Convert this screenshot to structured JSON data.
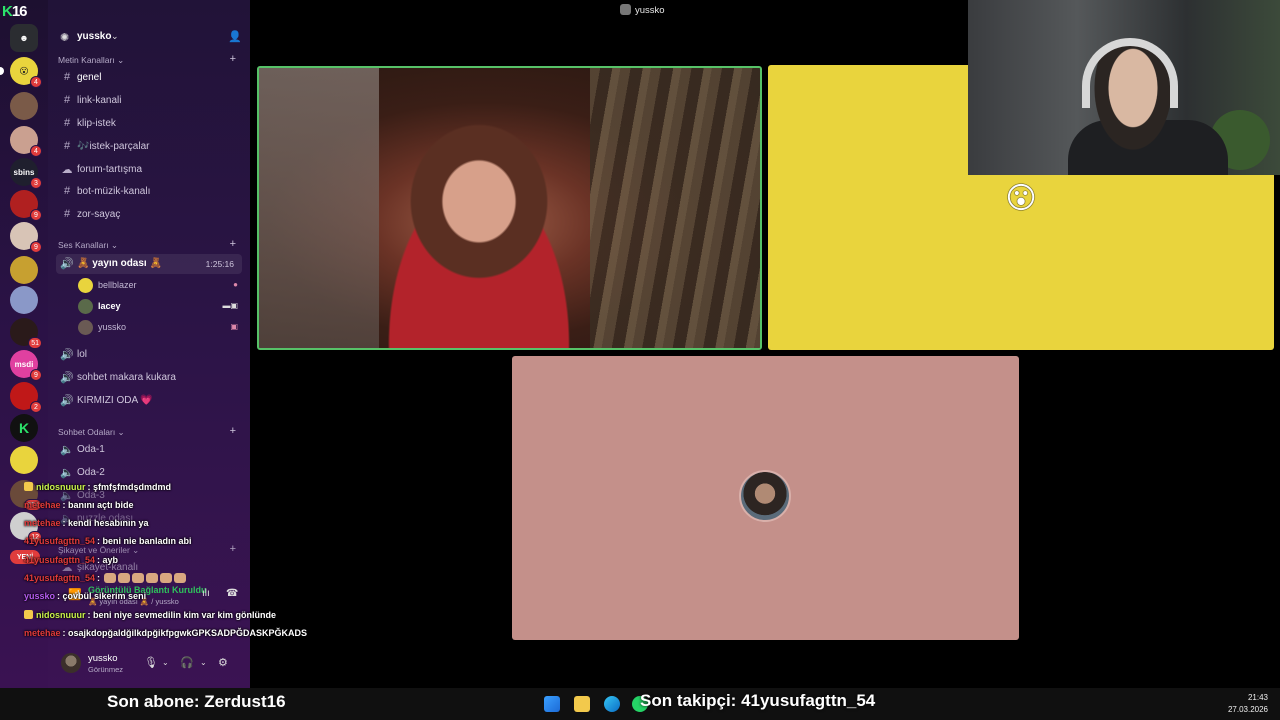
{
  "logo": {
    "k": "K",
    "num": "16"
  },
  "server": {
    "name": "yussko"
  },
  "categories": {
    "text": "Metin Kanalları",
    "voice": "Ses Kanalları",
    "chat_rooms": "Sohbet Odaları",
    "complaints": "Şikayet ve Öneriler"
  },
  "text_channels": [
    "genel",
    "link-kanali",
    "klip-istek",
    "🎶istek-parçalar",
    "forum-tartışma",
    "bot-müzik-kanalı",
    "zor-sayaç"
  ],
  "voice_channel_active": {
    "name": "🧸 yayın odası 🧸",
    "time": "1:25:16"
  },
  "voice_users": [
    "bellblazer",
    "lacey",
    "yussko"
  ],
  "voice_channels": [
    "lol",
    "sohbet makara kukara",
    "KIRMIZI ODA 💗"
  ],
  "chat_room_channels": [
    "Oda-1",
    "Oda-2",
    "Oda-3",
    "puzzle odası"
  ],
  "complaint_channel": "şikayet-kanalı",
  "voice_panel": {
    "status": "Görüntülü Bağlantı Kuruldu",
    "sub": "🧸 yayın odası 🧸 / yussko"
  },
  "user_panel": {
    "name": "yussko",
    "status": "Görünmez"
  },
  "rail_badges": [
    "4",
    "4",
    "3",
    "9",
    "9",
    "2",
    "51",
    "9",
    "2",
    "254",
    "12"
  ],
  "rail_label_sbins": "sbins",
  "rail_label_yeni": "YENİ",
  "rail_label_msdi": "msdi",
  "chat": [
    {
      "user": "nidosnuuur",
      "text": ": şfmfşfmdşdmdmd",
      "color": "green"
    },
    {
      "user": "metehae",
      "text": ": banını açtı bide",
      "color": "red"
    },
    {
      "user": "metehae",
      "text": ": kendi hesabının ya",
      "color": "red"
    },
    {
      "user": "41yusufagttn_54",
      "text": ": beni nie banladın abi",
      "color": "red"
    },
    {
      "user": "41yusufagttn_54",
      "text": ": ayb",
      "color": "red"
    },
    {
      "user": "41yusufagttn_54",
      "text": ":",
      "color": "red"
    },
    {
      "user": "yussko",
      "text": ": çovbül sikerim seni",
      "color": "purple"
    },
    {
      "user": "nidosnuuur",
      "text": ": beni niye sevmedilin kim var kim gönlünde",
      "color": "green"
    },
    {
      "user": "metehae",
      "text": ": osajkdopğaldğilkdpğikfpgwkGPKSADPĞDASKPĞKADS",
      "color": "red"
    }
  ],
  "call_title": "yussko",
  "taskbar": {
    "son_abone": "Son abone: Zerdust16",
    "son_takipci": "Son takipçi: 41yusufagttn_54",
    "time": "21:43",
    "date": "27.03.2026"
  },
  "colors": {
    "accent_green": "#57c268",
    "tile_yellow": "#e9d43d",
    "tile_pink": "#c4908a",
    "sidebar": "#2c1447"
  },
  "icons": [
    "discord-icon",
    "hash-icon",
    "speaker-icon",
    "forum-icon",
    "plus-icon",
    "mic-icon",
    "headphones-icon",
    "gear-icon",
    "invite-icon",
    "windows-icon",
    "folder-icon",
    "edge-icon",
    "whatsapp-icon"
  ]
}
